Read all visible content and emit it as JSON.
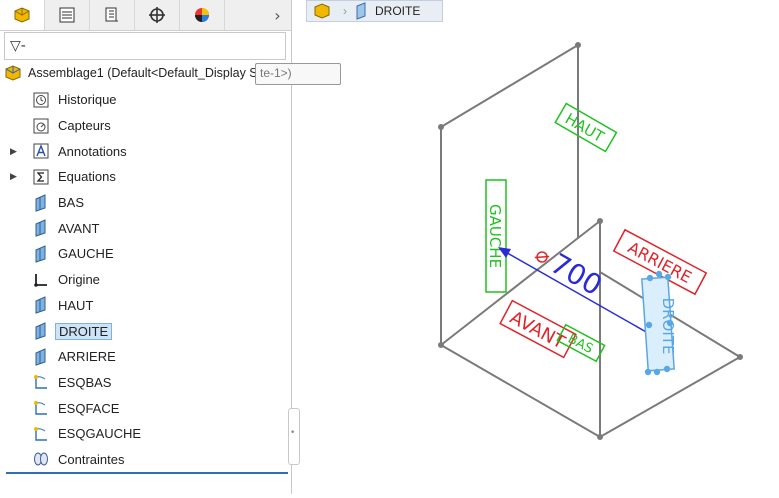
{
  "tabs": [
    {
      "name": "feature-manager-tab"
    },
    {
      "name": "property-manager-tab"
    },
    {
      "name": "configuration-manager-tab"
    },
    {
      "name": "dimxpert-tab"
    },
    {
      "name": "display-manager-tab"
    }
  ],
  "tabs_more": "›",
  "filter": {
    "symbol": "▽-"
  },
  "root": {
    "label": "Assemblage1  (Default<Default_Display Sta",
    "tooltip": "te-1>)"
  },
  "tree": [
    {
      "label": "Historique",
      "icon": "history-icon",
      "expandable": false
    },
    {
      "label": "Capteurs",
      "icon": "sensor-icon",
      "expandable": false
    },
    {
      "label": "Annotations",
      "icon": "annotation-icon",
      "expandable": true
    },
    {
      "label": "Equations",
      "icon": "equation-icon",
      "expandable": true
    },
    {
      "label": "BAS",
      "icon": "plane-icon",
      "expandable": false
    },
    {
      "label": "AVANT",
      "icon": "plane-icon",
      "expandable": false
    },
    {
      "label": "GAUCHE",
      "icon": "plane-icon",
      "expandable": false
    },
    {
      "label": "Origine",
      "icon": "origin-icon",
      "expandable": false
    },
    {
      "label": "HAUT",
      "icon": "plane-icon",
      "expandable": false
    },
    {
      "label": "DROITE",
      "icon": "plane-icon",
      "expandable": false,
      "selected": true
    },
    {
      "label": "ARRIERE",
      "icon": "plane-icon",
      "expandable": false
    },
    {
      "label": "ESQBAS",
      "icon": "sketch-icon",
      "expandable": false
    },
    {
      "label": "ESQFACE",
      "icon": "sketch-icon",
      "expandable": false
    },
    {
      "label": "ESQGAUCHE",
      "icon": "sketch-icon",
      "expandable": false
    },
    {
      "label": "Contraintes",
      "icon": "mates-icon",
      "expandable": false
    }
  ],
  "breadcrumb": {
    "item": "DROITE"
  },
  "viewport": {
    "plane_labels": {
      "haut": "HAUT",
      "gauche": "GAUCHE",
      "arriere": "ARRIERE",
      "avant": "AVANT",
      "bas": "BAS",
      "droite": "DROITE"
    },
    "dimension": "700",
    "colors": {
      "green": "#1fc21f",
      "red": "#e0242a",
      "blue": "#2a2ad8",
      "selection": "#5aa7e6",
      "edge": "#7a7a7a"
    }
  }
}
